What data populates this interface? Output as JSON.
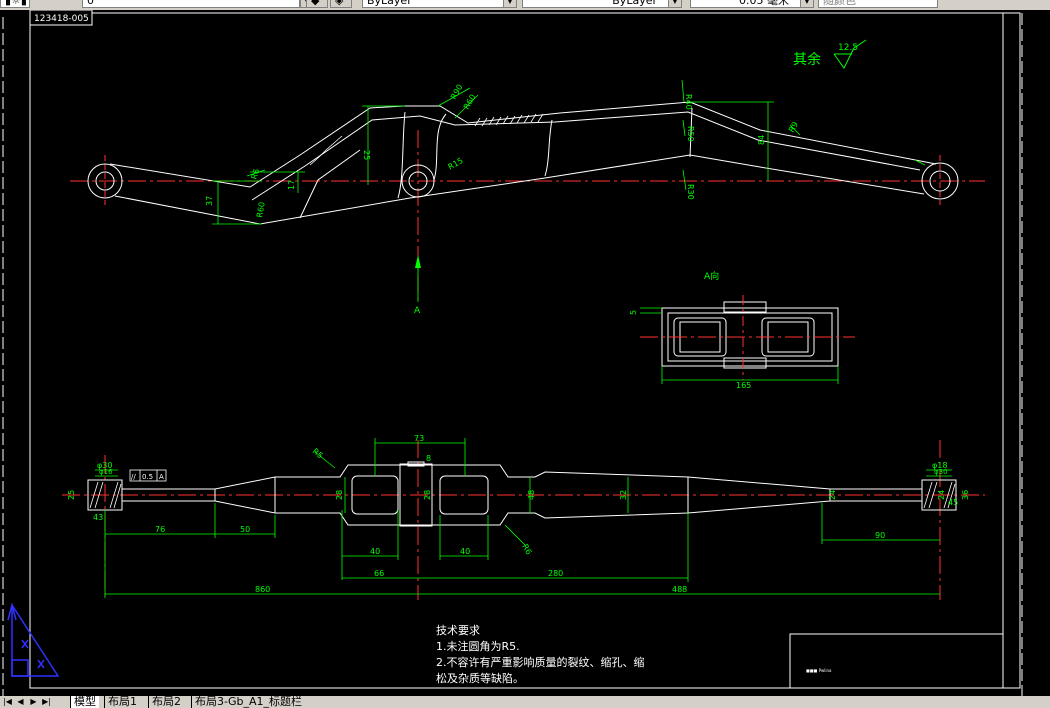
{
  "toolbar": {
    "layer_value": "0",
    "color_value": "ByLayer",
    "linetype_value": "ByLayer",
    "lineweight_value": "0.05 毫米",
    "plotstyle_value": "随颜色"
  },
  "title_stamp": "123418-005",
  "surface_note": {
    "prefix": "其余",
    "value": "12.5"
  },
  "view_label": "A向",
  "section_arrow_label": "A",
  "notes": {
    "heading": "技术要求",
    "line1": "1.未注圆角为R5.",
    "line2": "2.不容许有严重影响质量的裂纹、缩孔、缩",
    "line3": "松及杂质等缺陷。"
  },
  "tolerance_frame": {
    "symbol": "//",
    "value": "0.5",
    "datum": "A"
  },
  "dims_top": {
    "d1": "37",
    "d2": "17",
    "d3": "R6",
    "d4": "R60",
    "d5": "R90",
    "d6": "25",
    "d7": "R15",
    "d8": "R60",
    "d9": "R40",
    "d10": "R50",
    "d11": "84",
    "d12": "R30",
    "d13": "R9"
  },
  "dims_view": {
    "width": "165",
    "left": "5"
  },
  "dims_bottom": {
    "top_73": "73",
    "gap_8": "8",
    "r_5": "R5",
    "r_6": "R6",
    "h28a": "28",
    "h28b": "28",
    "h48": "48",
    "h32": "32",
    "h24": "24",
    "w40a": "40",
    "w40b": "40",
    "w66": "66",
    "w280": "280",
    "w76": "76",
    "w50": "50",
    "w90": "90",
    "w860": "860",
    "w488": "488",
    "dia30": "φ30",
    "dia16": "φ16",
    "h25": "25",
    "h43": "43",
    "dia18": "φ18",
    "dia30r": "φ30",
    "h24r": "24",
    "h45": "45",
    "h36": "36"
  },
  "title_block_text": "■■■ Pwlina",
  "layout_tabs": [
    "模型",
    "布局1",
    "布局2",
    "布局3-Gb_A1_标题栏"
  ],
  "active_tab": 0,
  "colors": {
    "background": "#000000",
    "outline": "#ffffff",
    "dimension": "#00ff00",
    "centerline": "#ff0000",
    "ucs": "#3030ff",
    "text": "#ffffff"
  }
}
